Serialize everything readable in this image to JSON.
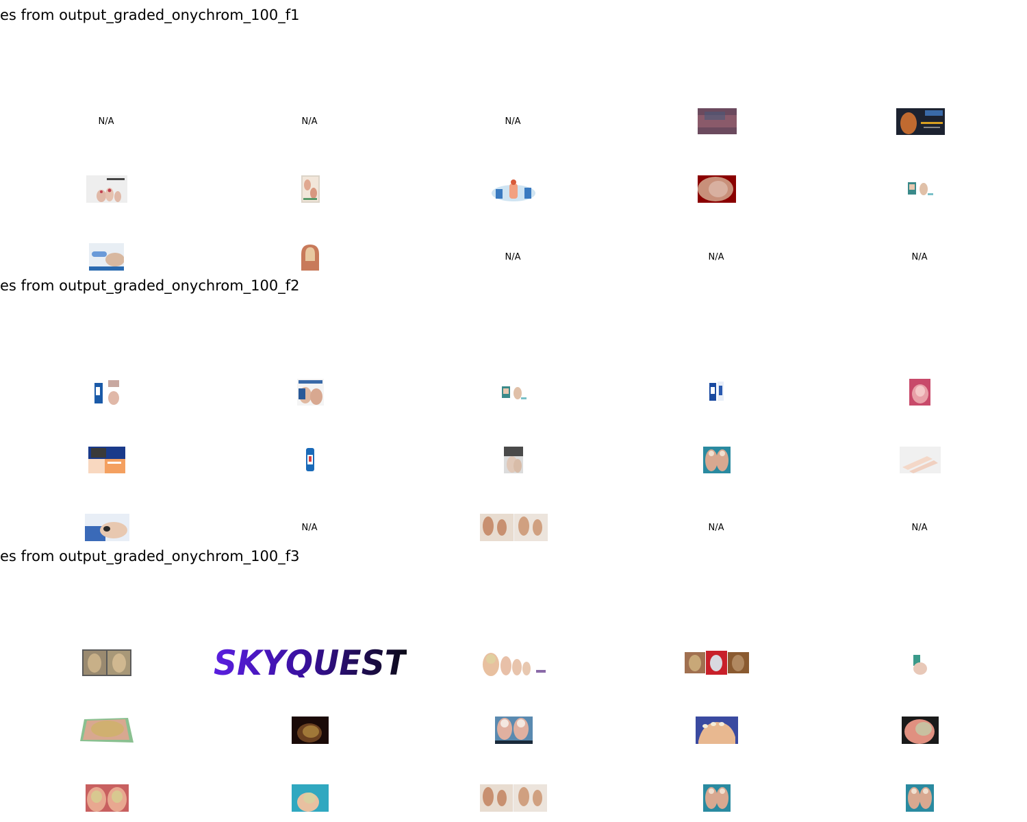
{
  "sections": [
    {
      "title": "es from output_graded_onychrom_100_f1",
      "rows": [
        [
          "N/A",
          "N/A",
          "N/A",
          "image",
          "image"
        ],
        [
          "image",
          "image",
          "image",
          "image",
          "image"
        ],
        [
          "image",
          "image",
          "N/A",
          "N/A",
          "N/A"
        ]
      ]
    },
    {
      "title": "es from output_graded_onychrom_100_f2",
      "rows": [
        [
          "image",
          "image",
          "image",
          "image",
          "image"
        ],
        [
          "image",
          "image",
          "image",
          "image",
          "image"
        ],
        [
          "image",
          "N/A",
          "image",
          "N/A",
          "N/A"
        ]
      ]
    },
    {
      "title": "es from output_graded_onychrom_100_f3",
      "rows": [
        [
          "image",
          "logo",
          "image",
          "image",
          "image"
        ],
        [
          "image",
          "image",
          "image",
          "image",
          "image"
        ],
        [
          "image",
          "image",
          "image",
          "image",
          "image"
        ]
      ]
    }
  ],
  "logo_text": "SKYQUEST",
  "colors": {
    "logo_start": "#5a1fe0",
    "logo_end": "#0a0a14"
  }
}
